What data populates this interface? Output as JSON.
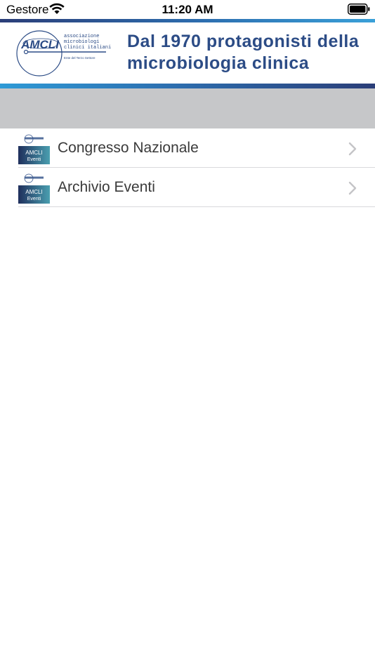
{
  "status_bar": {
    "carrier": "Gestore",
    "time": "11:20 AM"
  },
  "header": {
    "logo": {
      "mark": "AMCLI",
      "line1": "associazione",
      "line2": "microbiologi",
      "line3": "clinici italiani",
      "tagline": "Ente del Terzo Settore"
    },
    "title_line1": "Dal 1970 protagonisti della",
    "title_line2": "microbiologia clinica"
  },
  "menu": {
    "items": [
      {
        "label": "Congresso Nazionale",
        "thumb_top": "AMCLI",
        "thumb_bottom": "Eventi"
      },
      {
        "label": "Archivio Eventi",
        "thumb_top": "AMCLI",
        "thumb_bottom": "Eventi"
      }
    ]
  },
  "colors": {
    "brand_blue": "#2c4c86",
    "accent_blue": "#2d6fb0",
    "gray_band": "#c6c7c9",
    "thumb_navy": "#1f2f5c",
    "thumb_teal": "#4a9fb0"
  }
}
